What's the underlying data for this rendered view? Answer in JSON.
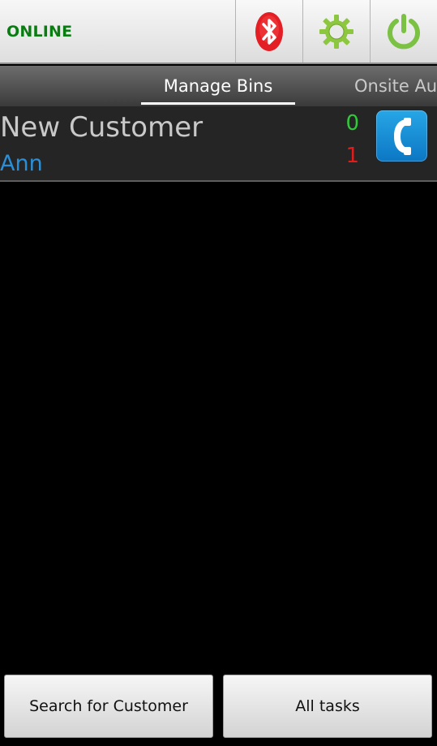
{
  "topbar": {
    "status": "ONLINE",
    "status_color": "#0a7d12",
    "buttons": [
      {
        "icon": "bluetooth-icon",
        "color": "#e31e24"
      },
      {
        "icon": "gear-icon",
        "color": "#8dc63f"
      },
      {
        "icon": "power-icon",
        "color": "#7bc143"
      }
    ]
  },
  "tabs": [
    {
      "label": "Manage Bins",
      "active": true
    },
    {
      "label": "Onsite Au",
      "active": false
    }
  ],
  "customer": {
    "name": "New Customer",
    "contact": "Ann",
    "count_green": "0",
    "count_red": "1",
    "call_icon": "phone-icon"
  },
  "bottom": {
    "search_label": "Search for Customer",
    "tasks_label": "All tasks"
  },
  "colors": {
    "accent_blue": "#2a8fd6",
    "count_green": "#31c93a",
    "count_red": "#e21b1b"
  }
}
